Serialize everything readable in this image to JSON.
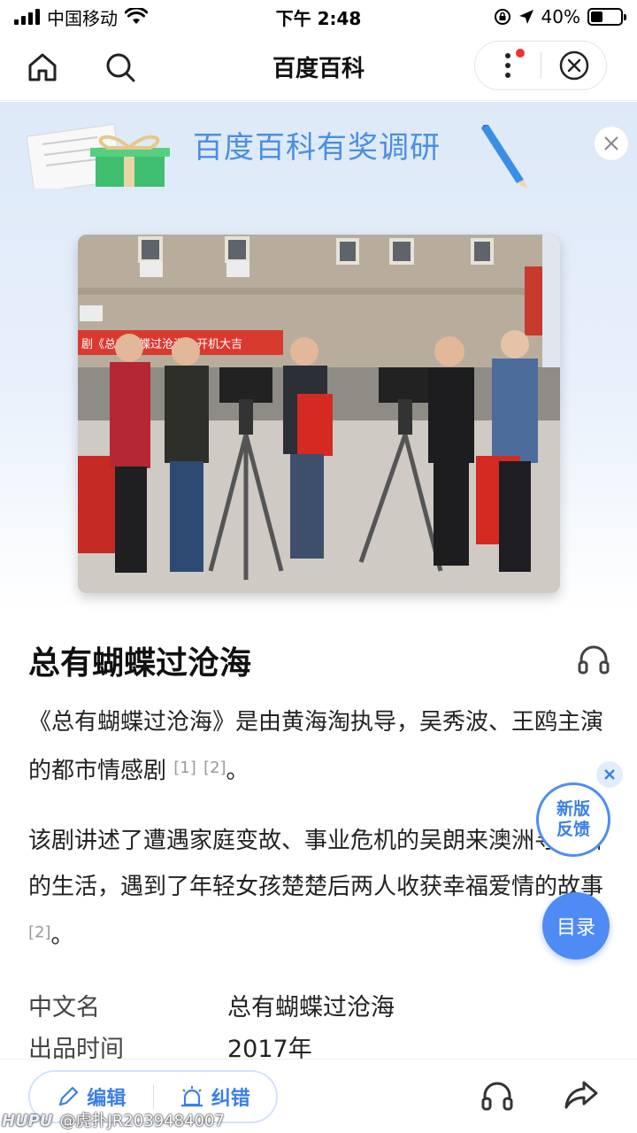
{
  "status_bar": {
    "carrier": "中国移动",
    "time": "下午 2:48",
    "battery_percent": "40%",
    "battery_level": 0.4
  },
  "nav": {
    "title": "百度百科"
  },
  "banner": {
    "text": "百度百科有奖调研"
  },
  "photo": {
    "sign_text": "剧《总有蝴蝶过沧海》开机大吉"
  },
  "article": {
    "title": "总有蝴蝶过沧海",
    "para1_text": "《总有蝴蝶过沧海》是由黄海淘执导，吴秀波、王鸥主演的都市情感剧",
    "para1_ref1": "[1]",
    "para1_ref2": "[2]",
    "para1_end": "。",
    "para2_text": "该剧讲述了遭遇家庭变故、事业危机的吴朗来澳洲寻找新的生活，遇到了年轻女孩楚楚后两人收获幸福爱情的故事",
    "para2_ref": "[2]",
    "para2_end": "。"
  },
  "infobox": [
    {
      "key": "中文名",
      "value": "总有蝴蝶过沧海"
    },
    {
      "key": "出品时间",
      "value": "2017年"
    }
  ],
  "floating": {
    "feedback_line1": "新版",
    "feedback_line2": "反馈",
    "toc_label": "目录"
  },
  "bottom_bar": {
    "edit_label": "编辑",
    "correct_label": "纠错"
  },
  "watermark": {
    "logo": "HUPU",
    "text": "@虎扑JR2039484007"
  },
  "colors": {
    "accent": "#4f8bf5",
    "banner_text": "#4a8fe0"
  }
}
